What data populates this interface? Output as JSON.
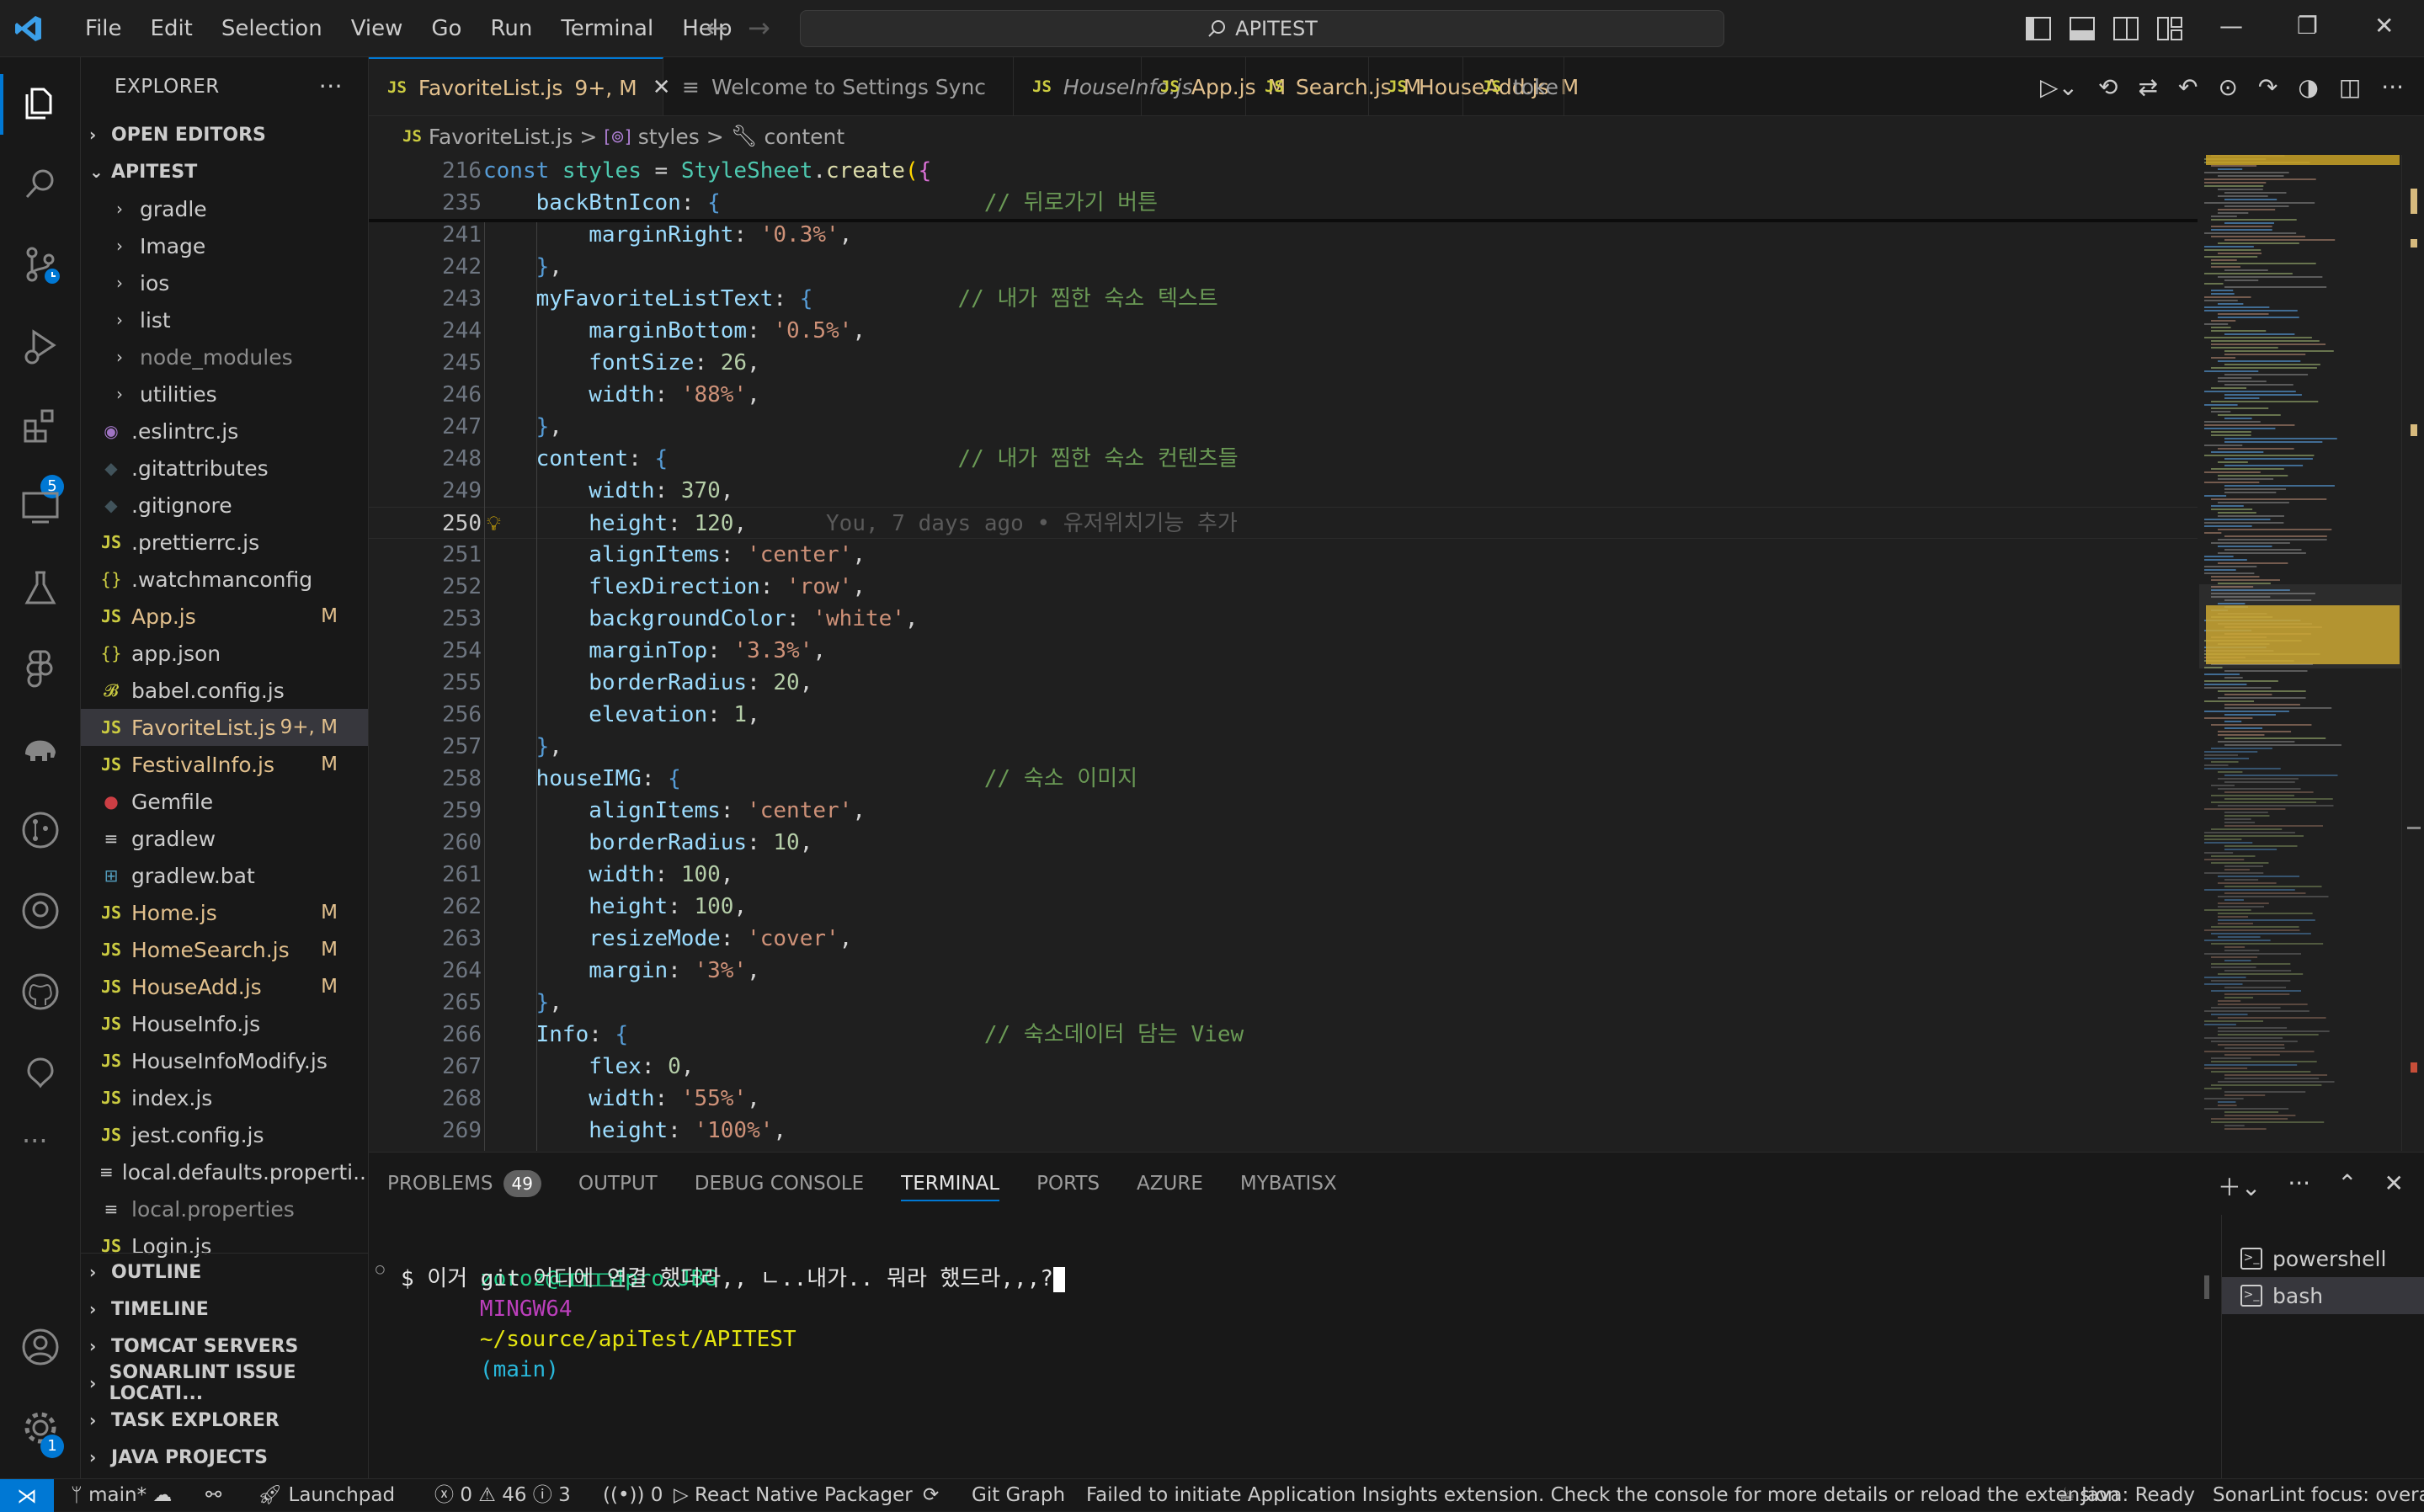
{
  "menu": [
    "File",
    "Edit",
    "Selection",
    "View",
    "Go",
    "Run",
    "Terminal",
    "Help"
  ],
  "command_center": {
    "label": "APITEST"
  },
  "activity_bar": {
    "extensions_badge": "5",
    "manage_badge": "1"
  },
  "sidebar": {
    "title": "EXPLORER",
    "open_editors": "OPEN EDITORS",
    "workspace": "APITEST",
    "items": [
      {
        "name": "gradle",
        "type": "folder"
      },
      {
        "name": "Image",
        "type": "folder"
      },
      {
        "name": "ios",
        "type": "folder"
      },
      {
        "name": "list",
        "type": "folder"
      },
      {
        "name": "node_modules",
        "type": "folder",
        "dim": true
      },
      {
        "name": "utilities",
        "type": "folder"
      },
      {
        "name": ".eslintrc.js",
        "type": "eslint"
      },
      {
        "name": ".gitattributes",
        "type": "git"
      },
      {
        "name": ".gitignore",
        "type": "git"
      },
      {
        "name": ".prettierrc.js",
        "type": "js"
      },
      {
        "name": ".watchmanconfig",
        "type": "json"
      },
      {
        "name": "App.js",
        "type": "js",
        "status": "M"
      },
      {
        "name": "app.json",
        "type": "json"
      },
      {
        "name": "babel.config.js",
        "type": "babel"
      },
      {
        "name": "FavoriteList.js",
        "type": "js",
        "status": "9+, M",
        "selected": true
      },
      {
        "name": "FestivalInfo.js",
        "type": "js",
        "status": "M"
      },
      {
        "name": "Gemfile",
        "type": "ruby"
      },
      {
        "name": "gradlew",
        "type": "text"
      },
      {
        "name": "gradlew.bat",
        "type": "windows"
      },
      {
        "name": "Home.js",
        "type": "js",
        "status": "M"
      },
      {
        "name": "HomeSearch.js",
        "type": "js",
        "status": "M"
      },
      {
        "name": "HouseAdd.js",
        "type": "js",
        "status": "M"
      },
      {
        "name": "HouseInfo.js",
        "type": "js"
      },
      {
        "name": "HouseInfoModify.js",
        "type": "js"
      },
      {
        "name": "index.js",
        "type": "js"
      },
      {
        "name": "jest.config.js",
        "type": "js"
      },
      {
        "name": "local.defaults.properti...",
        "type": "text"
      },
      {
        "name": "local.properties",
        "type": "text",
        "dim": true
      },
      {
        "name": "Login.js",
        "type": "js"
      }
    ],
    "bottom_sections": [
      "OUTLINE",
      "TIMELINE",
      "TOMCAT SERVERS",
      "SONARLINT ISSUE LOCATI...",
      "TASK EXPLORER",
      "JAVA PROJECTS"
    ]
  },
  "tabs": [
    {
      "label": "FavoriteList.js",
      "icon": "js",
      "status": "9+, M",
      "active": true
    },
    {
      "label": "Welcome to Settings Sync",
      "icon": "list"
    },
    {
      "label": "HouseInfo.js",
      "icon": "js",
      "italic": true
    },
    {
      "label": "App.js",
      "icon": "js",
      "status": "M"
    },
    {
      "label": "Search.js",
      "icon": "js",
      "status": "M"
    },
    {
      "label": "HouseAdd.js",
      "icon": "js",
      "status": "M"
    },
    {
      "label": "toke",
      "icon": "js"
    }
  ],
  "breadcrumb": {
    "file": "FavoriteList.js",
    "sep1": ">",
    "symbol1": "styles",
    "sep2": ">",
    "symbol2": "content"
  },
  "editor": {
    "blame": "You, 7 days ago • 유저위치기능 추가",
    "lines": [
      {
        "n": "216",
        "sticky": true,
        "tokens": [
          [
            "k",
            "const "
          ],
          [
            "t",
            "styles"
          ],
          [
            "p",
            " = "
          ],
          [
            "t",
            "StyleSheet"
          ],
          [
            "p",
            "."
          ],
          [
            "f",
            "create"
          ],
          [
            "y",
            "("
          ],
          [
            "b",
            "{"
          ]
        ]
      },
      {
        "n": "235",
        "sticky": true,
        "tokens": [
          [
            "v",
            "    backBtnIcon"
          ],
          [
            "p",
            ": "
          ],
          [
            "k",
            "{"
          ],
          [
            "p",
            "                    "
          ],
          [
            "c",
            "// 뒤로가기 버튼"
          ]
        ]
      },
      {
        "n": "241",
        "tokens": [
          [
            "v",
            "        marginRight"
          ],
          [
            "p",
            ": "
          ],
          [
            "s",
            "'0.3%'"
          ],
          [
            "p",
            ","
          ]
        ]
      },
      {
        "n": "242",
        "tokens": [
          [
            "k",
            "    }"
          ],
          [
            "p",
            ","
          ]
        ]
      },
      {
        "n": "243",
        "tokens": [
          [
            "v",
            "    myFavoriteListText"
          ],
          [
            "p",
            ": "
          ],
          [
            "k",
            "{"
          ],
          [
            "p",
            "           "
          ],
          [
            "c",
            "// 내가 찜한 숙소 텍스트"
          ]
        ]
      },
      {
        "n": "244",
        "tokens": [
          [
            "v",
            "        marginBottom"
          ],
          [
            "p",
            ": "
          ],
          [
            "s",
            "'0.5%'"
          ],
          [
            "p",
            ","
          ]
        ]
      },
      {
        "n": "245",
        "tokens": [
          [
            "v",
            "        fontSize"
          ],
          [
            "p",
            ": "
          ],
          [
            "n",
            "26"
          ],
          [
            "p",
            ","
          ]
        ]
      },
      {
        "n": "246",
        "tokens": [
          [
            "v",
            "        width"
          ],
          [
            "p",
            ": "
          ],
          [
            "s",
            "'88%'"
          ],
          [
            "p",
            ","
          ]
        ]
      },
      {
        "n": "247",
        "tokens": [
          [
            "k",
            "    }"
          ],
          [
            "p",
            ","
          ]
        ]
      },
      {
        "n": "248",
        "tokens": [
          [
            "v",
            "    content"
          ],
          [
            "p",
            ": "
          ],
          [
            "k",
            "{"
          ],
          [
            "p",
            "                      "
          ],
          [
            "c",
            "// 내가 찜한 숙소 컨텐츠들"
          ]
        ]
      },
      {
        "n": "249",
        "tokens": [
          [
            "v",
            "        width"
          ],
          [
            "p",
            ": "
          ],
          [
            "n",
            "370"
          ],
          [
            "p",
            ","
          ]
        ]
      },
      {
        "n": "250",
        "current": true,
        "tokens": [
          [
            "v",
            "        height"
          ],
          [
            "p",
            ": "
          ],
          [
            "n",
            "120"
          ],
          [
            "p",
            ","
          ]
        ]
      },
      {
        "n": "251",
        "tokens": [
          [
            "v",
            "        alignItems"
          ],
          [
            "p",
            ": "
          ],
          [
            "s",
            "'center'"
          ],
          [
            "p",
            ","
          ]
        ]
      },
      {
        "n": "252",
        "tokens": [
          [
            "v",
            "        flexDirection"
          ],
          [
            "p",
            ": "
          ],
          [
            "s",
            "'row'"
          ],
          [
            "p",
            ","
          ]
        ]
      },
      {
        "n": "253",
        "tokens": [
          [
            "v",
            "        backgroundColor"
          ],
          [
            "p",
            ": "
          ],
          [
            "s",
            "'white'"
          ],
          [
            "p",
            ","
          ]
        ]
      },
      {
        "n": "254",
        "tokens": [
          [
            "v",
            "        marginTop"
          ],
          [
            "p",
            ": "
          ],
          [
            "s",
            "'3.3%'"
          ],
          [
            "p",
            ","
          ]
        ]
      },
      {
        "n": "255",
        "tokens": [
          [
            "v",
            "        borderRadius"
          ],
          [
            "p",
            ": "
          ],
          [
            "n",
            "20"
          ],
          [
            "p",
            ","
          ]
        ]
      },
      {
        "n": "256",
        "tokens": [
          [
            "v",
            "        elevation"
          ],
          [
            "p",
            ": "
          ],
          [
            "n",
            "1"
          ],
          [
            "p",
            ","
          ]
        ]
      },
      {
        "n": "257",
        "tokens": [
          [
            "k",
            "    }"
          ],
          [
            "p",
            ","
          ]
        ]
      },
      {
        "n": "258",
        "tokens": [
          [
            "v",
            "    houseIMG"
          ],
          [
            "p",
            ": "
          ],
          [
            "k",
            "{"
          ],
          [
            "p",
            "                       "
          ],
          [
            "c",
            "// 숙소 이미지"
          ]
        ]
      },
      {
        "n": "259",
        "tokens": [
          [
            "v",
            "        alignItems"
          ],
          [
            "p",
            ": "
          ],
          [
            "s",
            "'center'"
          ],
          [
            "p",
            ","
          ]
        ]
      },
      {
        "n": "260",
        "tokens": [
          [
            "v",
            "        borderRadius"
          ],
          [
            "p",
            ": "
          ],
          [
            "n",
            "10"
          ],
          [
            "p",
            ","
          ]
        ]
      },
      {
        "n": "261",
        "tokens": [
          [
            "v",
            "        width"
          ],
          [
            "p",
            ": "
          ],
          [
            "n",
            "100"
          ],
          [
            "p",
            ","
          ]
        ]
      },
      {
        "n": "262",
        "tokens": [
          [
            "v",
            "        height"
          ],
          [
            "p",
            ": "
          ],
          [
            "n",
            "100"
          ],
          [
            "p",
            ","
          ]
        ]
      },
      {
        "n": "263",
        "tokens": [
          [
            "v",
            "        resizeMode"
          ],
          [
            "p",
            ": "
          ],
          [
            "s",
            "'cover'"
          ],
          [
            "p",
            ","
          ]
        ]
      },
      {
        "n": "264",
        "tokens": [
          [
            "v",
            "        margin"
          ],
          [
            "p",
            ": "
          ],
          [
            "s",
            "'3%'"
          ],
          [
            "p",
            ","
          ]
        ]
      },
      {
        "n": "265",
        "tokens": [
          [
            "k",
            "    }"
          ],
          [
            "p",
            ","
          ]
        ]
      },
      {
        "n": "266",
        "tokens": [
          [
            "v",
            "    Info"
          ],
          [
            "p",
            ": "
          ],
          [
            "k",
            "{"
          ],
          [
            "p",
            "                           "
          ],
          [
            "c",
            "// 숙소데이터 담는 View"
          ]
        ]
      },
      {
        "n": "267",
        "tokens": [
          [
            "v",
            "        flex"
          ],
          [
            "p",
            ": "
          ],
          [
            "n",
            "0"
          ],
          [
            "p",
            ","
          ]
        ]
      },
      {
        "n": "268",
        "tokens": [
          [
            "v",
            "        width"
          ],
          [
            "p",
            ": "
          ],
          [
            "s",
            "'55%'"
          ],
          [
            "p",
            ","
          ]
        ]
      },
      {
        "n": "269",
        "tokens": [
          [
            "v",
            "        height"
          ],
          [
            "p",
            ": "
          ],
          [
            "s",
            "'100%'"
          ],
          [
            "p",
            ","
          ]
        ]
      }
    ]
  },
  "panel": {
    "tabs": [
      "PROBLEMS",
      "OUTPUT",
      "DEBUG CONSOLE",
      "TERMINAL",
      "PORTS",
      "AZURE",
      "MYBATISX"
    ],
    "problems_count": "49",
    "active_tab": "TERMINAL",
    "terminal": {
      "user_host": "zoroz@□□□□4pro-JBG",
      "shell": "MINGW64",
      "path": "~/source/apiTest/APITEST",
      "branch": "(main)",
      "command": "$ 이거 git 어디에 연결 했더라,, ㄴ..내가.. 뭐라 했드라,,,?"
    },
    "terminals": [
      "powershell",
      "bash"
    ]
  },
  "statusbar": {
    "branch": "main*",
    "launchpad": "Launchpad",
    "errors": "0",
    "warnings": "46",
    "infos": "3",
    "ports": "0",
    "packager": "React Native Packager",
    "git_graph": "Git Graph",
    "message": "Failed to initiate Application Insights extension. Check the console for more details or reload the extension",
    "java": "Java: Ready",
    "sonarlint": "SonarLint focus: overall"
  },
  "colors": {
    "accent": "#0078d4",
    "modified": "#e2c08d",
    "js": "#cbcb41",
    "comment": "#6a9955"
  }
}
